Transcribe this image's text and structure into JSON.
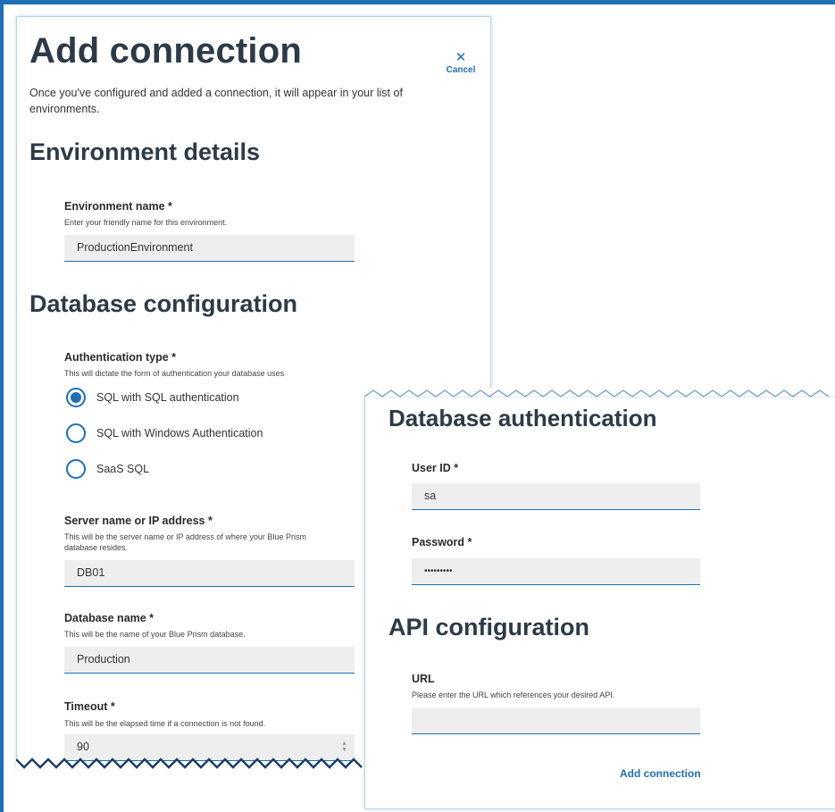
{
  "header": {
    "title": "Add connection",
    "intro": "Once you've configured and added a connection, it will appear in your list of environments.",
    "cancel_label": "Cancel"
  },
  "environment_details": {
    "heading": "Environment details",
    "name_label": "Environment name *",
    "name_help": "Enter your friendly name for this environment.",
    "name_value": "ProductionEnvironment"
  },
  "database_configuration": {
    "heading": "Database configuration",
    "auth_type_label": "Authentication type *",
    "auth_type_help": "This will dictate the form of authentication your database uses",
    "auth_options": [
      {
        "label": "SQL with SQL authentication",
        "selected": true
      },
      {
        "label": "SQL with Windows Authentication",
        "selected": false
      },
      {
        "label": "SaaS SQL",
        "selected": false
      }
    ],
    "server_label": "Server name or IP address *",
    "server_help": "This will be the server name or IP address of where your Blue Prism database resides.",
    "server_value": "DB01",
    "db_name_label": "Database name *",
    "db_name_help": "This will be the name of your Blue Prism database.",
    "db_name_value": "Production",
    "timeout_label": "Timeout *",
    "timeout_help": "This will be the elapsed time if a connection is not found.",
    "timeout_value": "90"
  },
  "database_authentication": {
    "heading": "Database authentication",
    "user_label": "User ID *",
    "user_value": "sa",
    "password_label": "Password *",
    "password_value": "•••••••••"
  },
  "api_configuration": {
    "heading": "API configuration",
    "url_label": "URL",
    "url_help": "Please enter the URL which references your desired API.",
    "url_value": ""
  },
  "footer": {
    "add_label": "Add connection"
  },
  "colors": {
    "accent": "#1f6fb5",
    "heading": "#2d3a47",
    "input_bg": "#eeeeee"
  },
  "icons": {
    "close": "close-icon",
    "spinner": "spinner-arrows-icon"
  }
}
